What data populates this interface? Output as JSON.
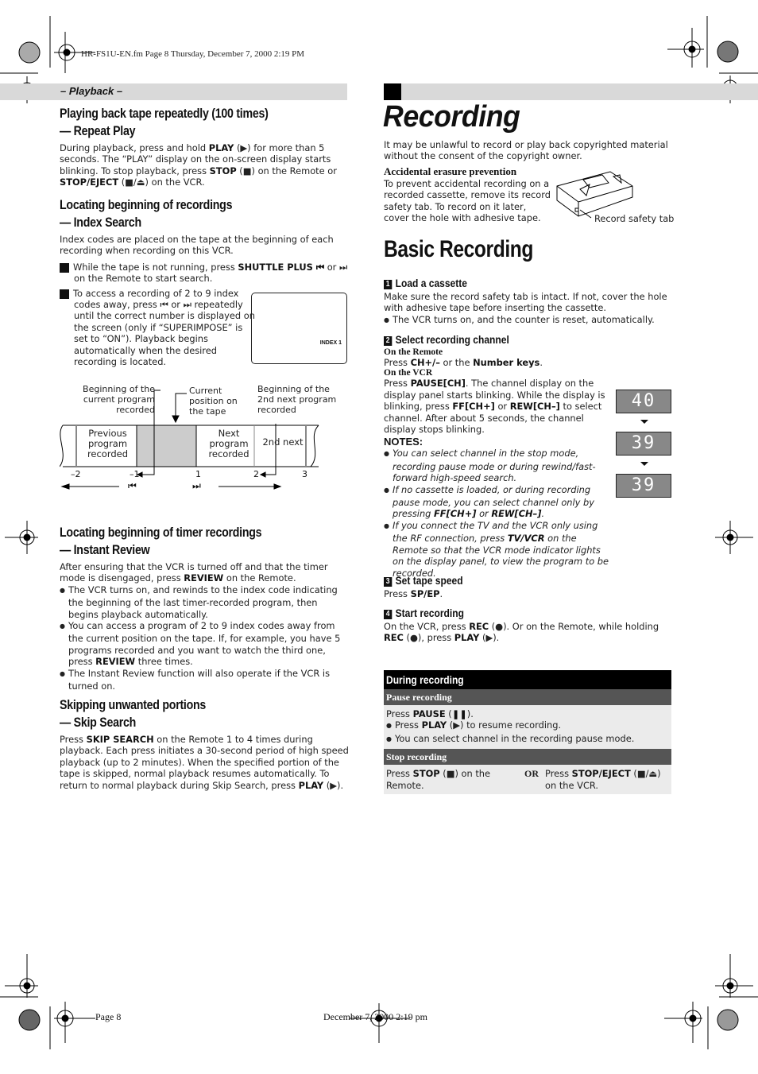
{
  "file_header": "HR-FS1U-EN.fm  Page 8  Thursday, December 7, 2000  2:19 PM",
  "section_label": "– Playback –",
  "left": {
    "repeat_play": {
      "title_line1": "Playing back tape repeatedly (100 times)",
      "title_line2": "— Repeat Play",
      "body": [
        {
          "t": "During playback, press and hold "
        },
        {
          "b": "PLAY"
        },
        {
          "t": " (▶) for more than 5 seconds. The “PLAY” display on the on-screen display starts blinking. To stop playback, press "
        },
        {
          "b": "STOP"
        },
        {
          "t": " (■) on the Remote or "
        },
        {
          "b": "STOP/EJECT"
        },
        {
          "t": " (■/⏏) on the VCR."
        }
      ]
    },
    "index_search": {
      "title_line1": "Locating beginning of recordings",
      "title_line2": "— Index Search",
      "intro": "Index codes are placed on the tape at the beginning of each recording when recording on this VCR.",
      "step1": [
        {
          "t": "While the tape is not running, press "
        },
        {
          "b": "SHUTTLE PLUS ⏮"
        },
        {
          "t": " or ⏭ on the Remote to start search."
        }
      ],
      "step2": "To access a recording of 2 to 9 index codes away, press ⏮ or ⏭ repeatedly until the correct number is displayed on the screen (only if “SUPERIMPOSE” is set to “ON”). Playback begins automatically when the desired recording is located.",
      "screen_text": "INDEX  1",
      "diagram": {
        "label_current_begin": "Beginning of the current program recorded",
        "label_current_pos": "Current position on the tape",
        "label_2nd_next_begin": "Beginning of the 2nd next program recorded",
        "seg_previous": "Previous program recorded",
        "seg_next": "Next program recorded",
        "seg_2nd_next": "2nd next",
        "ticks": [
          "–2",
          "–1",
          "1",
          "2",
          "3"
        ],
        "rew_symbol": "⏮",
        "ff_symbol": "⏭"
      }
    },
    "instant_review": {
      "title_line1": "Locating beginning of timer recordings",
      "title_line2": "— Instant Review",
      "intro": [
        {
          "t": "After ensuring that the VCR is turned off and that the timer mode is disengaged, press "
        },
        {
          "b": "REVIEW"
        },
        {
          "t": " on the Remote."
        }
      ],
      "bullets": [
        [
          {
            "t": "The VCR turns on, and rewinds to the index code indicating the beginning of the last timer-recorded program, then begins playback automatically."
          }
        ],
        [
          {
            "t": "You can access a program of 2 to 9 index codes away from the current position on the tape. If, for example, you have 5 programs recorded and you want to watch the third one, press "
          },
          {
            "b": "REVIEW"
          },
          {
            "t": " three times."
          }
        ],
        [
          {
            "t": "The Instant Review function will also operate if the VCR is turned on."
          }
        ]
      ]
    },
    "skip_search": {
      "title_line1": "Skipping unwanted portions",
      "title_line2": "— Skip Search",
      "body": [
        {
          "t": "Press "
        },
        {
          "b": "SKIP SEARCH"
        },
        {
          "t": " on the Remote 1 to 4 times during playback. Each press initiates a 30-second period of high speed playback (up to 2 minutes). When the specified portion of the tape is skipped, normal playback resumes automatically. To return to normal playback during Skip Search, press "
        },
        {
          "b": "PLAY"
        },
        {
          "t": " (▶)."
        }
      ]
    }
  },
  "right": {
    "title": "Recording",
    "warning": "It may be unlawful to record or play back copyrighted material without the consent of the copyright owner.",
    "erasure": {
      "heading": "Accidental erasure prevention",
      "body": "To prevent accidental recording on a recorded cassette, remove its record safety tab. To record on it later, cover the hole with adhesive tape.",
      "callout": "Record safety tab"
    },
    "basic_title": "Basic Recording",
    "steps": [
      {
        "num": "1",
        "heading": "Load a cassette"
      },
      {
        "num": "2",
        "heading": "Select recording channel"
      },
      {
        "num": "3",
        "heading": "Set tape speed"
      },
      {
        "num": "4",
        "heading": "Start recording"
      }
    ],
    "step1_body": "Make sure the record safety tab is intact. If not, cover the hole with adhesive tape before inserting the cassette.",
    "step1_bullet": "The VCR turns on, and the counter is reset, automatically.",
    "step2": {
      "remote_label": "On the Remote",
      "remote_body": [
        {
          "t": "Press "
        },
        {
          "b": "CH+/–"
        },
        {
          "t": " or the "
        },
        {
          "b": "Number keys"
        },
        {
          "t": "."
        }
      ],
      "vcr_label": "On the VCR",
      "vcr_body": [
        {
          "t": "Press "
        },
        {
          "b": "PAUSE[CH]"
        },
        {
          "t": ". The channel display on the display panel starts blinking. While the display is blinking, press "
        },
        {
          "b": "FF[CH+]"
        },
        {
          "t": " or "
        },
        {
          "b": "REW[CH–]"
        },
        {
          "t": " to select channel. After about 5 seconds, the channel display stops blinking."
        }
      ],
      "notes_label": "NOTES:",
      "notes": [
        [
          {
            "t": "You can select channel in the stop mode, recording pause mode or during rewind/fast-forward high-speed search."
          }
        ],
        [
          {
            "t": "If no cassette is loaded, or during recording pause mode, you can select channel only by pressing "
          },
          {
            "b": "FF[CH+]"
          },
          {
            "t": " or "
          },
          {
            "b": "REW[CH–]"
          },
          {
            "t": "."
          }
        ],
        [
          {
            "t": "If you connect the TV and the VCR only using the RF connection, press "
          },
          {
            "b": "TV/VCR"
          },
          {
            "t": " on the Remote so that the VCR mode indicator lights on the display panel, to view the program to be recorded."
          }
        ]
      ],
      "displays": [
        "40",
        "39",
        "39"
      ]
    },
    "step3_body": [
      {
        "t": "Press "
      },
      {
        "b": "SP/EP"
      },
      {
        "t": "."
      }
    ],
    "step4_body": [
      {
        "t": "On the VCR, press "
      },
      {
        "b": "REC"
      },
      {
        "t": " (●). Or on the Remote, while holding "
      },
      {
        "b": "REC"
      },
      {
        "t": " (●), press "
      },
      {
        "b": "PLAY"
      },
      {
        "t": " (▶)."
      }
    ],
    "during_table": {
      "title": "During recording",
      "pause_label": "Pause recording",
      "pause_body": [
        {
          "t": "Press "
        },
        {
          "b": "PAUSE"
        },
        {
          "t": " ("
        },
        {
          "b": "❚❚"
        },
        {
          "t": ")."
        }
      ],
      "pause_bullets": [
        [
          {
            "t": "Press "
          },
          {
            "b": "PLAY"
          },
          {
            "t": " (▶) to resume recording."
          }
        ],
        [
          {
            "t": "You can select channel in the recording pause mode."
          }
        ]
      ],
      "stop_label": "Stop recording",
      "stop_left": [
        {
          "t": "Press "
        },
        {
          "b": "STOP"
        },
        {
          "t": " (■) on the Remote."
        }
      ],
      "stop_or": "OR",
      "stop_right": [
        {
          "t": "Press "
        },
        {
          "b": "STOP/EJECT"
        },
        {
          "t": " (■/⏏) on the VCR."
        }
      ]
    }
  },
  "footer": {
    "page": "Page 8",
    "date": "December 7, 2000 2:19 pm"
  }
}
